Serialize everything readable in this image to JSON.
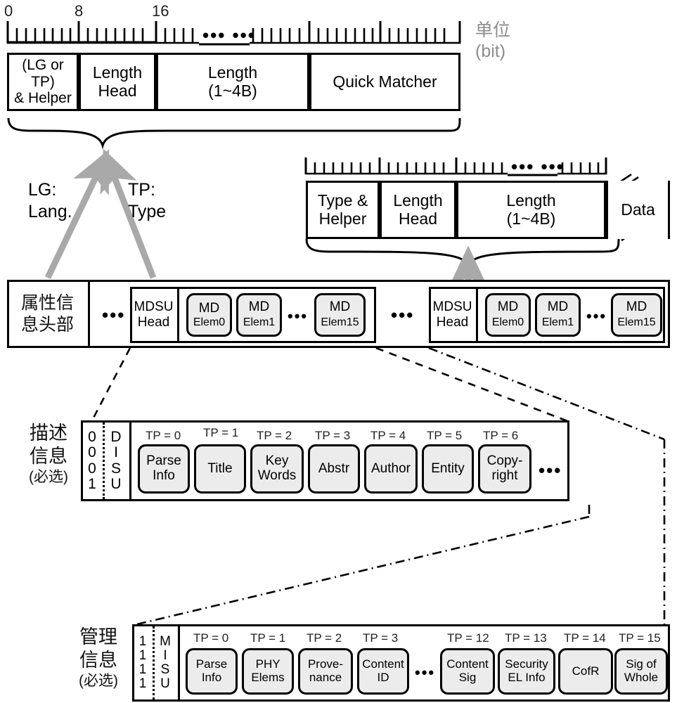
{
  "diagram": {
    "unit_label": {
      "line1": "单位",
      "line2": "(bit)"
    },
    "ruler_top": {
      "ticks": [
        "0",
        "8",
        "16"
      ],
      "ellipsis": "•••   •••"
    },
    "ruler_mid": {
      "ellipsis": "•••   •••"
    },
    "header_top": {
      "fields": [
        {
          "line1": "(LG or TP)",
          "line2": "& Helper"
        },
        {
          "line1": "Length",
          "line2": "Head"
        },
        {
          "line1": "Length",
          "line2": "(1~4B)"
        },
        {
          "line1": "Quick Matcher",
          "line2": ""
        }
      ]
    },
    "header_mid": {
      "fields": [
        {
          "line1": "Type &",
          "line2": "Helper"
        },
        {
          "line1": "Length",
          "line2": "Head"
        },
        {
          "line1": "Length",
          "line2": "(1~4B)"
        },
        {
          "line1": "Data",
          "line2": ""
        }
      ]
    },
    "arrow_labels": [
      {
        "line1": "LG:",
        "line2": "Lang."
      },
      {
        "line1": "TP:",
        "line2": "Type"
      }
    ],
    "attr_row": {
      "head": {
        "line1": "属性信",
        "line2": "息头部"
      },
      "ellipsis": "•••",
      "mdsu": [
        {
          "head": {
            "line1": "MDSU",
            "line2": "Head"
          },
          "elements": [
            {
              "line1": "MD",
              "line2": "Elem0"
            },
            {
              "line1": "MD",
              "line2": "Elem1"
            },
            {
              "line1": "MD",
              "line2": "Elem15"
            }
          ],
          "ellipsis": "•••"
        },
        {
          "head": {
            "line1": "MDSU",
            "line2": "Head"
          },
          "elements": [
            {
              "line1": "MD",
              "line2": "Elem0"
            },
            {
              "line1": "MD",
              "line2": "Elem1"
            },
            {
              "line1": "MD",
              "line2": "Elem15"
            }
          ],
          "ellipsis": "•••"
        }
      ]
    },
    "desc_section": {
      "caption": {
        "line1": "描述",
        "line2": "信息",
        "line3": "(必选)"
      },
      "bits": [
        "0",
        "0",
        "0",
        "1"
      ],
      "unit_code": [
        "D",
        "I",
        "S",
        "U"
      ],
      "ellipsis": "•••",
      "items": [
        {
          "tp": "TP = 0",
          "line1": "Parse",
          "line2": "Info"
        },
        {
          "tp": "TP = 1",
          "line1": "Title",
          "line2": ""
        },
        {
          "tp": "TP = 2",
          "line1": "Key",
          "line2": "Words"
        },
        {
          "tp": "TP = 3",
          "line1": "Abstr",
          "line2": ""
        },
        {
          "tp": "TP = 4",
          "line1": "Author",
          "line2": ""
        },
        {
          "tp": "TP = 5",
          "line1": "Entity",
          "line2": ""
        },
        {
          "tp": "TP = 6",
          "line1": "Copy-",
          "line2": "right"
        }
      ]
    },
    "mgmt_section": {
      "caption": {
        "line1": "管理",
        "line2": "信息",
        "line3": "(必选)"
      },
      "bits": [
        "1",
        "1",
        "1",
        "1"
      ],
      "unit_code": [
        "M",
        "I",
        "S",
        "U"
      ],
      "ellipsis": "•••",
      "items_left": [
        {
          "tp": "TP = 0",
          "line1": "Parse",
          "line2": "Info"
        },
        {
          "tp": "TP = 1",
          "line1": "PHY",
          "line2": "Elems"
        },
        {
          "tp": "TP = 2",
          "line1": "Prove-",
          "line2": "nance"
        },
        {
          "tp": "TP = 3",
          "line1": "Content",
          "line2": "ID"
        }
      ],
      "items_right": [
        {
          "tp": "TP = 12",
          "line1": "Content",
          "line2": "Sig"
        },
        {
          "tp": "TP = 13",
          "line1": "Security",
          "line2": "EL Info"
        },
        {
          "tp": "TP = 14",
          "line1": "CofR",
          "line2": ""
        },
        {
          "tp": "TP = 15",
          "line1": "Sig of",
          "line2": "Whole"
        }
      ]
    },
    "colors": {
      "arrow": "#a9a9a9",
      "pill_fill": "#ececec",
      "unit_text": "#8d8d8d",
      "line": "#000000"
    }
  }
}
